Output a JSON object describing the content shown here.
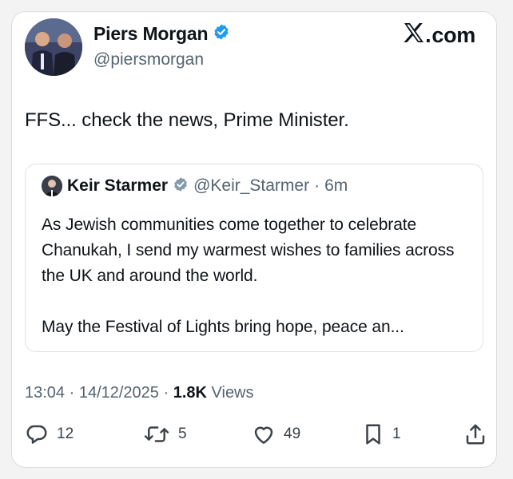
{
  "tweet": {
    "author_name": "Piers Morgan",
    "author_handle": "@piersmorgan",
    "text": "FFS... check the news, Prime Minister.",
    "timestamp": "13:04 · 14/12/2025",
    "views_count": "1.8K",
    "views_label": "Views"
  },
  "brand": {
    "label": "com"
  },
  "quoted": {
    "author_name": "Keir Starmer",
    "author_handle": "@Keir_Starmer",
    "separator": "·",
    "time": "6m",
    "text": "As Jewish communities come together to celebrate Chanukah, I send my warmest wishes to families across the UK and around the world.\n\nMay the Festival of Lights bring hope, peace an..."
  },
  "actions": {
    "replies": "12",
    "reposts": "5",
    "likes": "49",
    "bookmarks": "1"
  },
  "colors": {
    "verified": "#1d9bf0",
    "verified_gray": "#829aab",
    "secondary_text": "#536471"
  },
  "icons": [
    "verified-badge-icon",
    "x-logo-icon",
    "reply-icon",
    "repost-icon",
    "like-icon",
    "bookmark-icon",
    "share-icon"
  ]
}
